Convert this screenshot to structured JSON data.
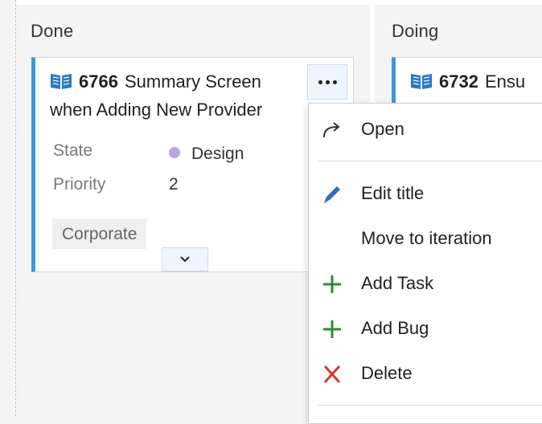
{
  "columns": [
    {
      "title": "Done"
    },
    {
      "title": "Doing"
    }
  ],
  "cards": [
    {
      "id": "6766",
      "title_line1": "Summary Screen",
      "title_line2": "when Adding New Provider",
      "state_label": "State",
      "state_value": "Design",
      "state_color": "#b7a4e0",
      "priority_label": "Priority",
      "priority_value": "2",
      "tag": "Corporate",
      "icon": "book-icon",
      "accent_color": "#3a9ad6"
    },
    {
      "id": "6732",
      "title_partial": "Ensu",
      "icon": "book-icon",
      "accent_color": "#3a9ad6"
    }
  ],
  "context_menu": {
    "items": [
      {
        "label": "Open",
        "icon": "open-arrow-icon"
      },
      {
        "label": "Edit title",
        "icon": "pencil-icon",
        "icon_color": "#2f6fc4"
      },
      {
        "label": "Move to iteration",
        "icon": ""
      },
      {
        "label": "Add Task",
        "icon": "plus-icon",
        "icon_color": "#2e8b2e"
      },
      {
        "label": "Add Bug",
        "icon": "plus-icon",
        "icon_color": "#2e8b2e"
      },
      {
        "label": "Delete",
        "icon": "x-icon",
        "icon_color": "#d23a2a"
      }
    ]
  }
}
